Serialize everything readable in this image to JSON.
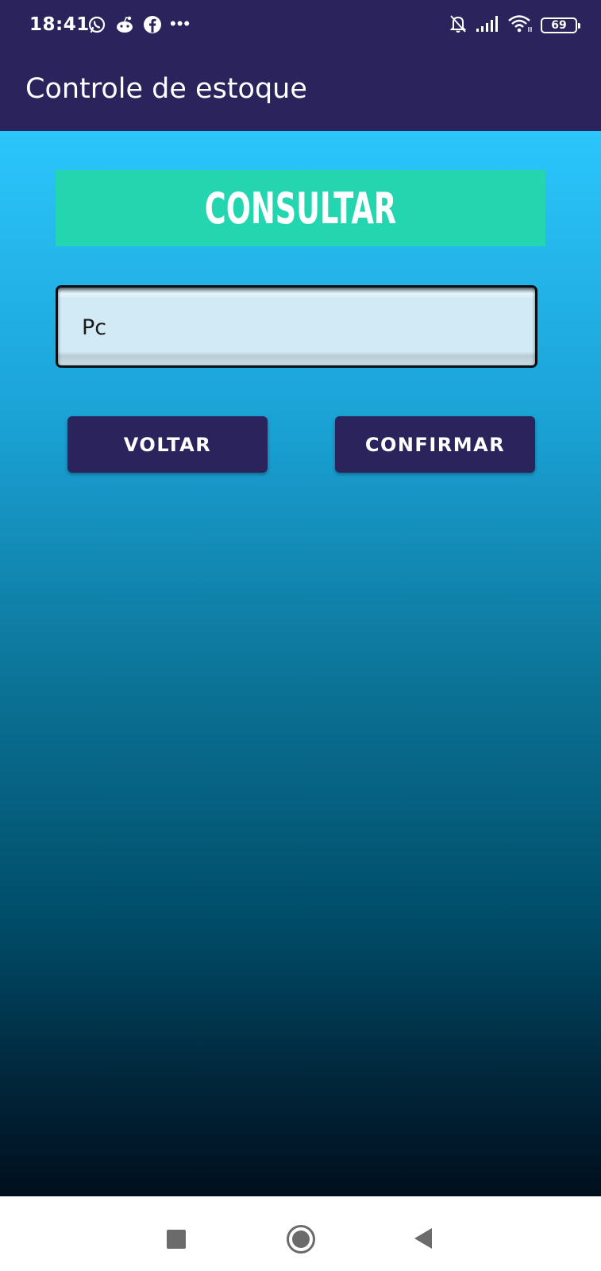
{
  "status_bar": {
    "time": "18:41",
    "left_icons": [
      "whatsapp-icon",
      "reddit-icon",
      "facebook-icon",
      "more-dots-icon"
    ],
    "more_indicator": "•••",
    "right_icons": [
      "bell-off-icon",
      "signal-icon",
      "wifi-icon",
      "battery-icon"
    ],
    "battery_level": "69"
  },
  "app_bar": {
    "title": "Controle de estoque"
  },
  "form": {
    "header": "CONSULTAR",
    "query_value": "Pc",
    "back_label": "VOLTAR",
    "confirm_label": "CONFIRMAR"
  },
  "nav_bar": {
    "buttons": [
      "recents-icon",
      "home-icon",
      "back-icon"
    ]
  },
  "colors": {
    "primary": "#2a235c",
    "header_banner": "#24d6b0",
    "gradient_top": "#2bc6fc",
    "gradient_bottom": "#000f1d",
    "field_background": "#d1eaf5"
  }
}
